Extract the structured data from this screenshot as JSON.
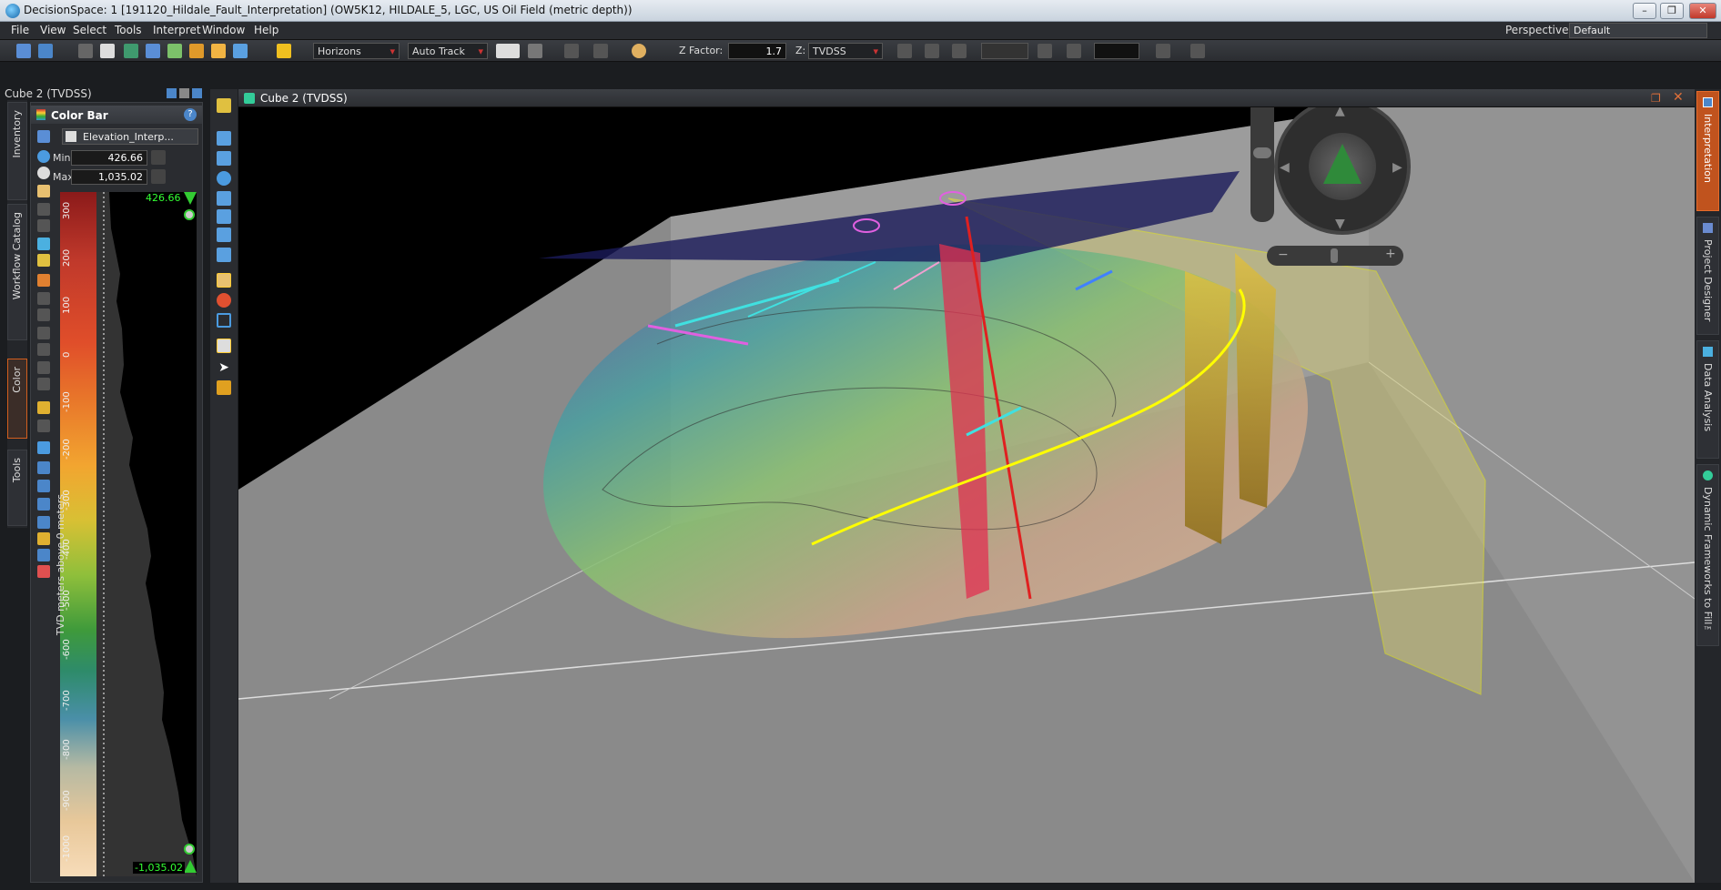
{
  "window": {
    "title": "DecisionSpace: 1 [191120_Hildale_Fault_Interpretation] (OW5K12, HILDALE_5, LGC, US Oil Field (metric depth))",
    "minimize": "–",
    "restore": "❐",
    "close": "✕"
  },
  "menu": [
    "File",
    "View",
    "Select",
    "Tools",
    "Interpret",
    "Window",
    "Help"
  ],
  "perspective": {
    "label": "Perspective:",
    "value": "Default"
  },
  "toolbar": {
    "horizons": "Horizons",
    "track": "Auto Track",
    "zfactor_label": "Z Factor:",
    "zfactor_value": "1.7",
    "z_label": "Z:",
    "z_value": "TVDSS"
  },
  "left_panel": {
    "title": "Cube 2 (TVDSS)",
    "tabs": [
      "Inventory",
      "Workflow Catalog",
      "Color",
      "Tools"
    ]
  },
  "colorbar": {
    "title": "Color Bar",
    "attribute": "Elevation_Interp...",
    "min_label": "Min",
    "min_value": "426.66",
    "max_label": "Max",
    "max_value": "1,035.02",
    "axis_label": "TVD meters above 0 meters",
    "top_value": "426.66",
    "bottom_value": "-1,035.02",
    "ticks": [
      "300",
      "200",
      "100",
      "0",
      "-100",
      "-200",
      "-300",
      "-400",
      "-500",
      "-600",
      "-700",
      "-800",
      "-900",
      "-1000"
    ]
  },
  "viewport": {
    "title": "Cube 2 (TVDSS)"
  },
  "right_tabs": [
    "Interpretation",
    "Project Designer",
    "Data Analysis",
    "Dynamic Frameworks to Fill™"
  ]
}
